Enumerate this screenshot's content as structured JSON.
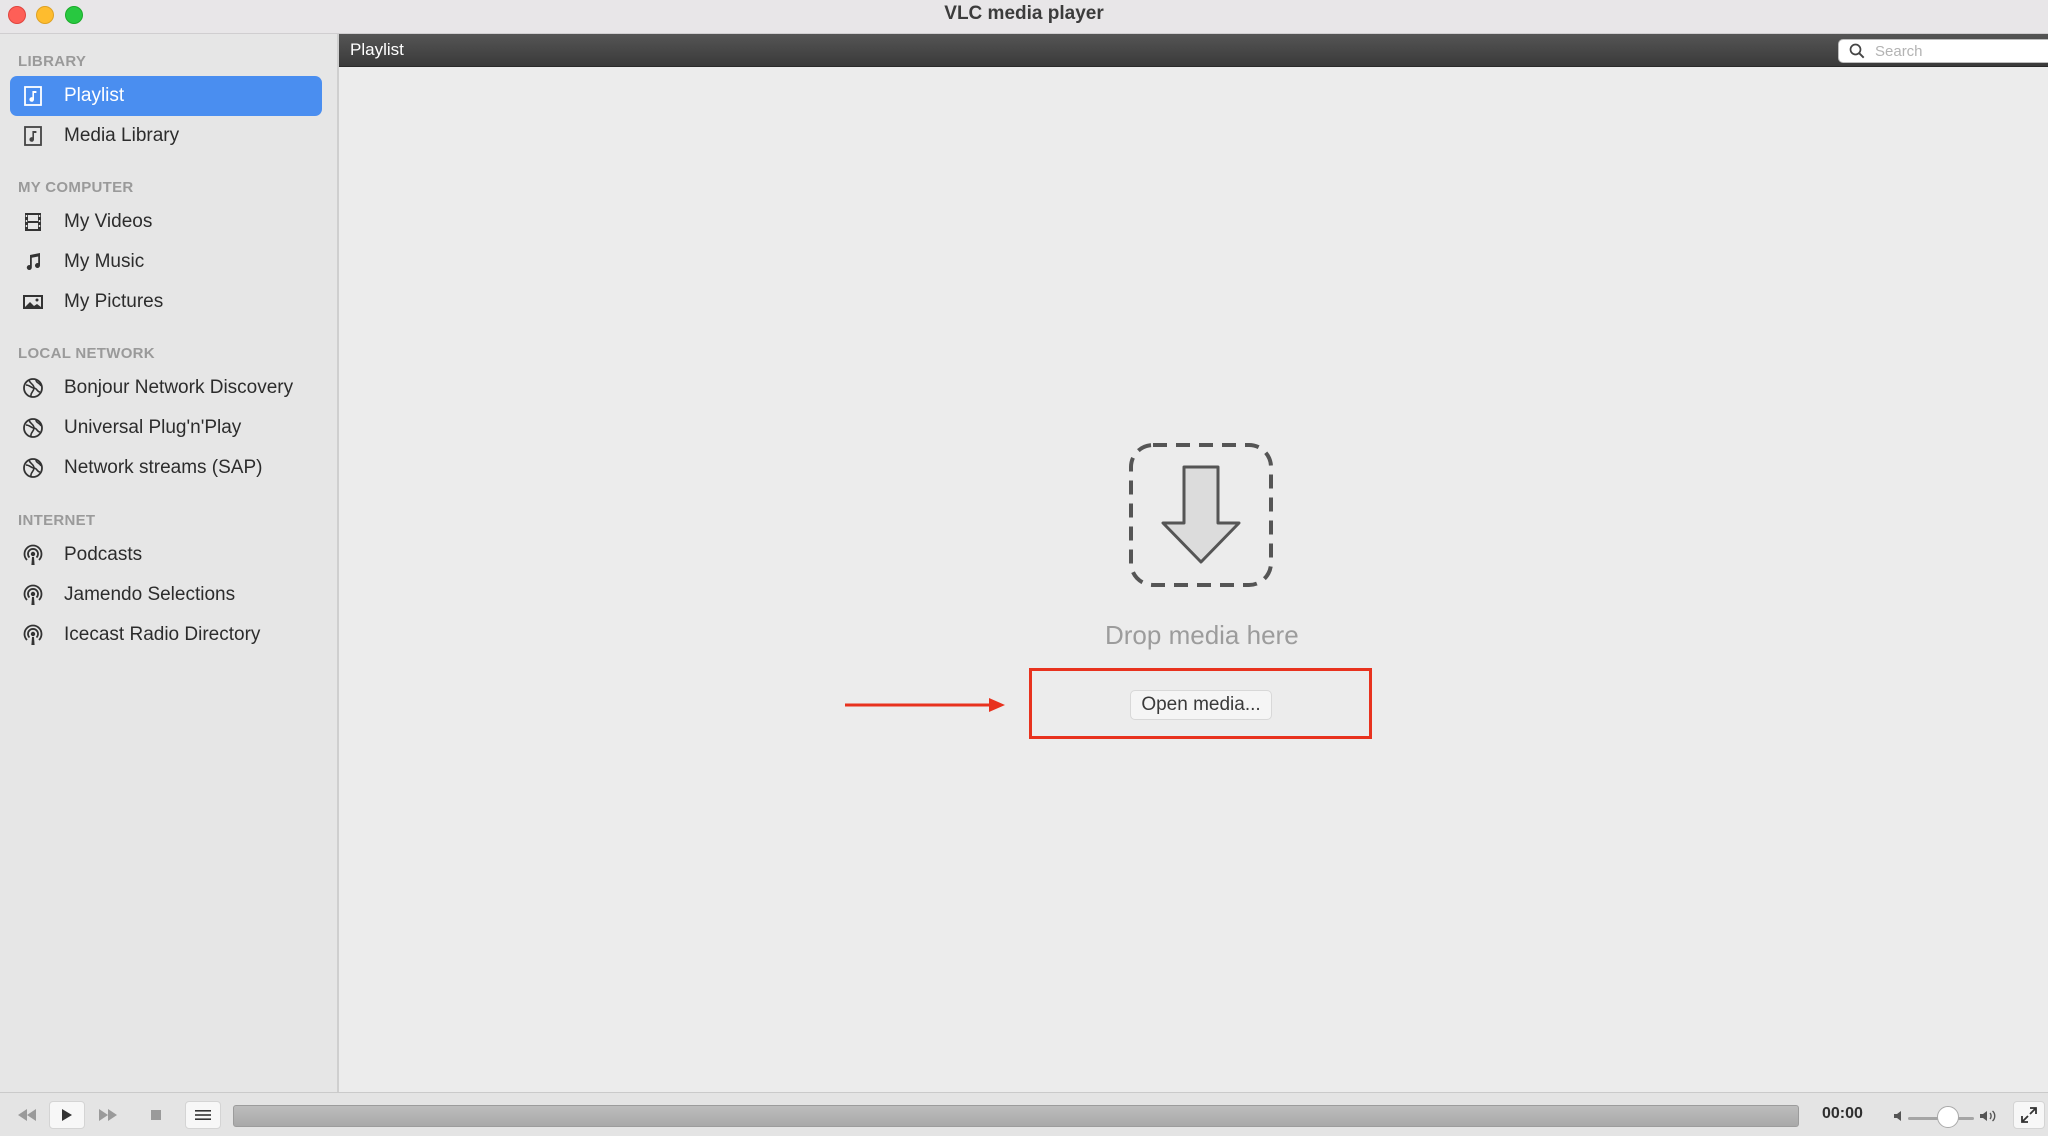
{
  "window": {
    "title": "VLC media player"
  },
  "sidebar": {
    "sections": [
      {
        "header": "LIBRARY",
        "items": [
          {
            "label": "Playlist",
            "icon": "playlist-icon",
            "selected": true
          },
          {
            "label": "Media Library",
            "icon": "media-library-icon"
          }
        ]
      },
      {
        "header": "MY COMPUTER",
        "items": [
          {
            "label": "My Videos",
            "icon": "film-icon"
          },
          {
            "label": "My Music",
            "icon": "music-note-icon"
          },
          {
            "label": "My Pictures",
            "icon": "picture-icon"
          }
        ]
      },
      {
        "header": "LOCAL NETWORK",
        "items": [
          {
            "label": "Bonjour Network Discovery",
            "icon": "network-icon"
          },
          {
            "label": "Universal Plug'n'Play",
            "icon": "network-icon"
          },
          {
            "label": "Network streams (SAP)",
            "icon": "network-icon"
          }
        ]
      },
      {
        "header": "INTERNET",
        "items": [
          {
            "label": "Podcasts",
            "icon": "podcast-icon"
          },
          {
            "label": "Jamendo Selections",
            "icon": "podcast-icon"
          },
          {
            "label": "Icecast Radio Directory",
            "icon": "podcast-icon"
          }
        ]
      }
    ]
  },
  "main": {
    "header_title": "Playlist",
    "search_placeholder": "Search",
    "drop_text": "Drop media here",
    "open_button_label": "Open media..."
  },
  "controls": {
    "time": "00:00",
    "volume_level": 0.6
  },
  "colors": {
    "selection": "#4a8ef0",
    "annotation": "#e8321e"
  }
}
